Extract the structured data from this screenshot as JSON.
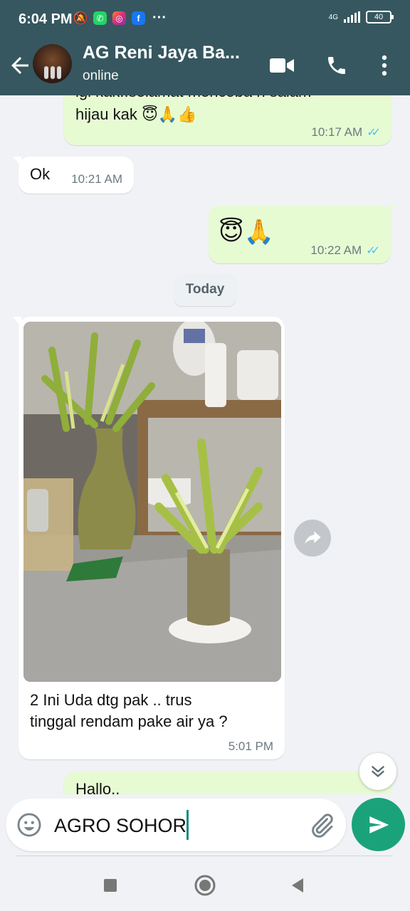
{
  "status_bar": {
    "time": "6:04 PM",
    "network": "4G",
    "battery": "40"
  },
  "header": {
    "contact_name": "AG Reni Jaya Ba...",
    "contact_status": "online"
  },
  "messages": [
    {
      "direction": "out",
      "text_line1": "igi kak..selamat mencoba n salam",
      "text_line2": "hijau kak 😇🙏👍",
      "time": "10:17 AM",
      "status": "read"
    },
    {
      "direction": "in",
      "text": "Ok",
      "time": "10:21 AM"
    },
    {
      "direction": "out",
      "text": "😇🙏",
      "time": "10:22 AM",
      "status": "read"
    },
    {
      "direction": "in",
      "type": "image",
      "image_description": "Lucky bamboo plants arranged on a shelf",
      "caption_line1": "2 Ini Uda dtg pak .. trus",
      "caption_line2": "tinggal rendam pake air ya ?",
      "time": "5:01 PM"
    },
    {
      "direction": "out",
      "text": "Hallo.."
    }
  ],
  "day_separator": "Today",
  "composer": {
    "value": "AGRO SOHOR"
  },
  "icons": {
    "back": "back-arrow-icon",
    "video": "video-call-icon",
    "call": "phone-icon",
    "menu": "more-vert-icon",
    "emoji": "emoji-icon",
    "attach": "paperclip-icon",
    "send": "send-icon",
    "forward": "forward-icon",
    "scroll": "double-chevron-down-icon"
  },
  "colors": {
    "header": "#36575f",
    "outgoing_bubble": "#e7fbd3",
    "incoming_bubble": "#ffffff",
    "send_button": "#1aa37a",
    "read_ticks": "#53bdeb"
  }
}
